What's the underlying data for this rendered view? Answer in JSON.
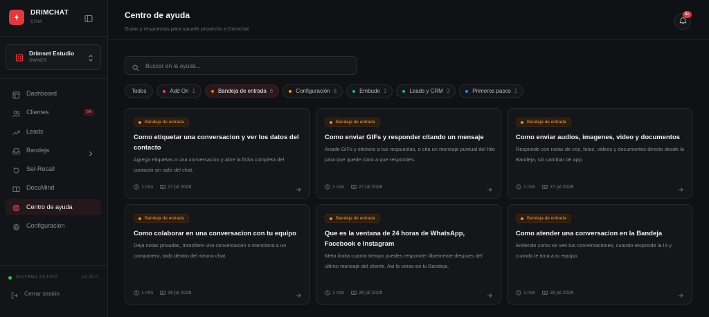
{
  "brand": {
    "name": "DRIMCHAT",
    "sub": "CRM"
  },
  "workspace": {
    "name": "Drimset Estudio",
    "role": "OWNER"
  },
  "nav": [
    {
      "label": "Dashboard",
      "icon": "dashboard-icon"
    },
    {
      "label": "Clientes",
      "icon": "users-icon",
      "badge": "5A"
    },
    {
      "label": "Leads",
      "icon": "trending-icon"
    },
    {
      "label": "Bandeja",
      "icon": "inbox-icon",
      "chevron": true
    },
    {
      "label": "Sel-Recall",
      "icon": "recall-icon"
    },
    {
      "label": "DocuMind",
      "icon": "book-icon"
    },
    {
      "label": "Centro de ayuda",
      "icon": "lifebuoy-icon",
      "active": true
    },
    {
      "label": "Configuración",
      "icon": "gear-icon"
    }
  ],
  "system": {
    "label": "SISTEMA ACTIVO",
    "version": "v1.37.0"
  },
  "logout": "Cerrar sesión",
  "header": {
    "title": "Centro de ayuda",
    "subtitle": "Guías y respuestas para sacarle provecho a Drimchat",
    "notification_badge": "9+"
  },
  "search": {
    "placeholder": "Buscar en la ayuda...",
    "value": ""
  },
  "filters": [
    {
      "label": "Todos",
      "count": "",
      "color": ""
    },
    {
      "label": "Add On",
      "count": "1",
      "color": "#ef4444"
    },
    {
      "label": "Bandeja de entrada",
      "count": "6",
      "color": "#f97316",
      "active": true
    },
    {
      "label": "Configuración",
      "count": "6",
      "color": "#f59e0b"
    },
    {
      "label": "Embudo",
      "count": "1",
      "color": "#14b8a6"
    },
    {
      "label": "Leads y CRM",
      "count": "3",
      "color": "#10b981"
    },
    {
      "label": "Primeros pasos",
      "count": "2",
      "color": "#3b82f6"
    }
  ],
  "articles": [
    {
      "tag": "Bandeja de entrada",
      "title": "Como etiquetar una conversacion y ver los datos del contacto",
      "desc": "Agrega etiquetas a una conversacion y abre la ficha completa del contacto sin salir del chat.",
      "read_time": "1 min",
      "date": "27 jul 2026"
    },
    {
      "tag": "Bandeja de entrada",
      "title": "Como enviar GIFs y responder citando un mensaje",
      "desc": "Anade GIFs y stickers a tus respuestas, o cita un mensaje puntual del hilo para que quede claro a que respondes.",
      "read_time": "1 min",
      "date": "27 jul 2026"
    },
    {
      "tag": "Bandeja de entrada",
      "title": "Como enviar audios, imagenes, video y documentos",
      "desc": "Responde con notas de voz, fotos, videos y documentos directo desde la Bandeja, sin cambiar de app.",
      "read_time": "1 min",
      "date": "27 jul 2026"
    },
    {
      "tag": "Bandeja de entrada",
      "title": "Como colaborar en una conversacion con tu equipo",
      "desc": "Deja notas privadas, transfiere una conversacion o menciona a un companero, todo dentro del mismo chat.",
      "read_time": "1 min",
      "date": "26 jul 2026"
    },
    {
      "tag": "Bandeja de entrada",
      "title": "Que es la ventana de 24 horas de WhatsApp, Facebook e Instagram",
      "desc": "Meta limita cuanto tiempo puedes responder libremente despues del ultimo mensaje del cliente. Asi lo veras en tu Bandeja.",
      "read_time": "1 min",
      "date": "26 jul 2026"
    },
    {
      "tag": "Bandeja de entrada",
      "title": "Como atender una conversacion en la Bandeja",
      "desc": "Entiende como se ven tus conversaciones, cuando responde la IA y cuando le toca a tu equipo.",
      "read_time": "1 min",
      "date": "26 jul 2026"
    }
  ]
}
